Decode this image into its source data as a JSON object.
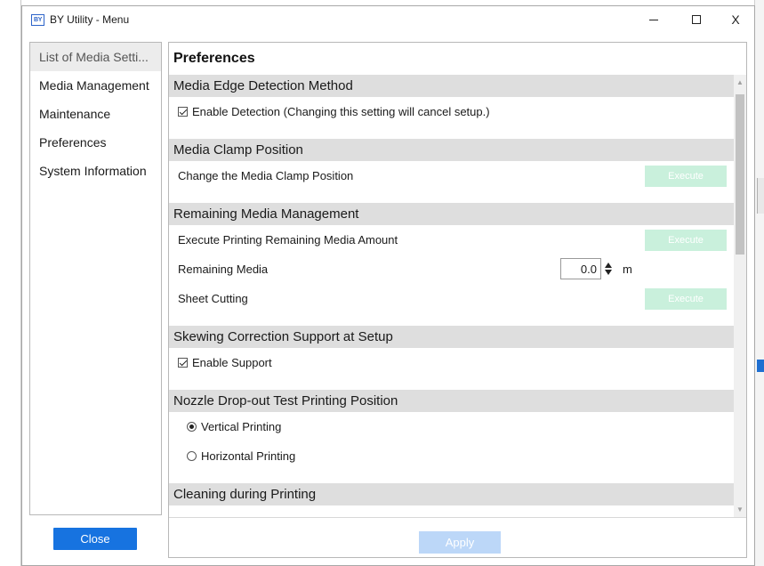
{
  "window": {
    "title": "BY Utility - Menu",
    "icon_text": "BY",
    "minimize_icon": "minimize-icon",
    "maximize_icon": "maximize-icon",
    "close_glyph": "X"
  },
  "sidebar": {
    "items": [
      {
        "label": "List of Media Setti...",
        "selected": true
      },
      {
        "label": "Media Management",
        "selected": false
      },
      {
        "label": "Maintenance",
        "selected": false
      },
      {
        "label": "Preferences",
        "selected": false
      },
      {
        "label": "System Information",
        "selected": false
      }
    ],
    "close_label": "Close"
  },
  "main": {
    "title": "Preferences",
    "sections": {
      "edge": {
        "header": "Media Edge Detection Method",
        "checkbox_label": "Enable Detection (Changing this setting will cancel setup.)",
        "checked": true
      },
      "clamp": {
        "header": "Media Clamp Position",
        "row_label": "Change the Media Clamp Position",
        "button": "Execute"
      },
      "remaining": {
        "header": "Remaining Media Management",
        "print_label": "Execute Printing Remaining Media Amount",
        "print_button": "Execute",
        "media_label": "Remaining Media",
        "media_value": "0.0",
        "media_unit": "m",
        "cut_label": "Sheet Cutting",
        "cut_button": "Execute"
      },
      "skew": {
        "header": "Skewing Correction Support at Setup",
        "checkbox_label": "Enable Support",
        "checked": true
      },
      "nozzle": {
        "header": "Nozzle Drop-out Test Printing Position",
        "option_vertical": "Vertical Printing",
        "option_horizontal": "Horizontal Printing",
        "selected": "Vertical Printing"
      },
      "cleaning": {
        "header": "Cleaning during Printing"
      }
    },
    "apply_label": "Apply"
  },
  "colors": {
    "close_button": "#1773e0",
    "execute_disabled": "#c9f0dc",
    "apply_disabled": "#bcd7f8",
    "section_header_bg": "#dedede"
  }
}
